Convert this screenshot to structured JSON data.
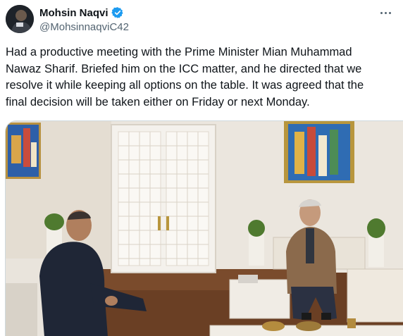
{
  "author": {
    "display_name": "Mohsin Naqvi",
    "handle": "@MohsinnaqviC42",
    "verified": true,
    "avatar_icon": "profile-avatar",
    "verified_icon": "verified-badge-icon",
    "verified_color": "#1d9bf0"
  },
  "menu": {
    "icon": "more-options-icon"
  },
  "tweet": {
    "lines": [
      "Had a productive meeting with the Prime Minister Mian Muhammad",
      "Nawaz Sharif. Briefed him on the ICC matter, and he directed that we",
      "resolve it while keeping all options on the table. It was agreed that the",
      "final decision will be taken either on Friday or next Monday."
    ]
  },
  "media": {
    "type": "photo"
  }
}
